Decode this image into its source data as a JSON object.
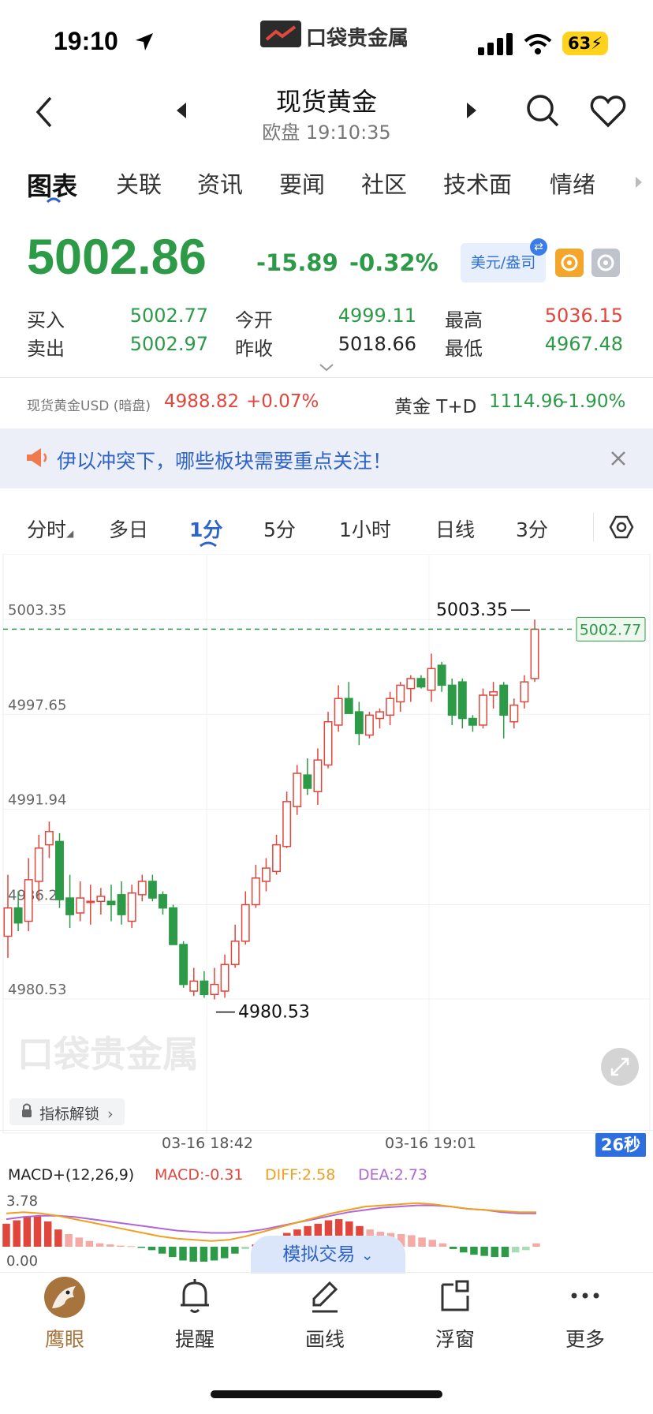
{
  "status_bar": {
    "time": "19:10",
    "app_logo": "口袋贵金属",
    "battery": "63"
  },
  "header": {
    "title": "现货黄金",
    "subtitle": "欧盘 19:10:35"
  },
  "tabs": [
    "图表",
    "关联",
    "资讯",
    "要闻",
    "社区",
    "技术面",
    "情绪"
  ],
  "price": {
    "last": "5002.86",
    "change": "-15.89",
    "change_pct": "-0.32%",
    "currency_label": "美元/盎司",
    "direction": "down"
  },
  "quote": {
    "bid_label": "买入",
    "bid": "5002.77",
    "ask_label": "卖出",
    "ask": "5002.97",
    "open_label": "今开",
    "open": "4999.11",
    "prev_close_label": "昨收",
    "prev_close": "5018.66",
    "high_label": "最高",
    "high": "5036.15",
    "low_label": "最低",
    "low": "4967.48"
  },
  "ticker": {
    "left_name": "现货黄金USD (暗盘)",
    "left_price": "4988.82",
    "left_change": "+0.07%",
    "right_name": "黄金 T+D",
    "right_price": "1114.96",
    "right_change": "-1.90%"
  },
  "banner": {
    "text": "伊以冲突下，哪些板块需要重点关注！"
  },
  "periods": [
    "分时",
    "多日",
    "1分",
    "5分",
    "1小时",
    "日线",
    "3分"
  ],
  "chart_data": {
    "type": "candlestick",
    "interval": "1分",
    "y_ticks": [
      "5003.35",
      "4997.65",
      "4991.94",
      "4986.2",
      "4980.53"
    ],
    "ylim": [
      4979.53,
      5004.45
    ],
    "x_ticks": [
      "03-16 18:42",
      "03-16 19:01"
    ],
    "max_label": "5003.35",
    "min_label": "4980.53",
    "last_price_tag": "5002.77",
    "up_color": "#e0463c",
    "down_color": "#2c9a47",
    "ohlc": [
      [
        4984.3,
        4988.0,
        4983.0,
        4986.0
      ],
      [
        4986.0,
        4987.0,
        4984.6,
        4985.1
      ],
      [
        4985.2,
        4989.0,
        4984.6,
        4987.7
      ],
      [
        4987.6,
        4990.4,
        4986.4,
        4989.6
      ],
      [
        4989.8,
        4991.2,
        4989.0,
        4990.6
      ],
      [
        4990.0,
        4990.5,
        4986.0,
        4986.5
      ],
      [
        4986.6,
        4988.0,
        4984.8,
        4985.6
      ],
      [
        4985.7,
        4987.6,
        4985.2,
        4986.6
      ],
      [
        4986.4,
        4987.4,
        4985.0,
        4986.4
      ],
      [
        4986.4,
        4987.2,
        4985.6,
        4986.7
      ],
      [
        4986.4,
        4987.4,
        4985.2,
        4986.2
      ],
      [
        4986.8,
        4987.6,
        4985.0,
        4985.6
      ],
      [
        4985.2,
        4987.4,
        4984.8,
        4986.9
      ],
      [
        4986.8,
        4988.0,
        4986.4,
        4987.6
      ],
      [
        4987.6,
        4988.0,
        4986.4,
        4986.6
      ],
      [
        4986.8,
        4987.0,
        4985.6,
        4986.0
      ],
      [
        4986.0,
        4986.2,
        4983.8,
        4983.8
      ],
      [
        4983.8,
        4984.0,
        4981.2,
        4981.4
      ],
      [
        4981.0,
        4982.4,
        4980.7,
        4981.6
      ],
      [
        4981.6,
        4982.2,
        4980.6,
        4980.8
      ],
      [
        4980.8,
        4982.4,
        4980.5,
        4981.4
      ],
      [
        4981.0,
        4983.2,
        4980.6,
        4982.6
      ],
      [
        4982.6,
        4985.0,
        4982.4,
        4984.0
      ],
      [
        4984.0,
        4987.0,
        4983.8,
        4986.2
      ],
      [
        4986.2,
        4988.6,
        4986.0,
        4987.8
      ],
      [
        4987.6,
        4989.0,
        4987.0,
        4988.4
      ],
      [
        4988.2,
        4990.4,
        4988.0,
        4989.8
      ],
      [
        4989.7,
        4993.0,
        4989.6,
        4992.4
      ],
      [
        4992.1,
        4994.6,
        4991.6,
        4994.1
      ],
      [
        4994.0,
        4995.0,
        4992.8,
        4993.2
      ],
      [
        4993.0,
        4995.6,
        4992.2,
        4994.9
      ],
      [
        4994.6,
        4997.8,
        4994.4,
        4997.2
      ],
      [
        4997.0,
        4999.4,
        4996.6,
        4998.6
      ],
      [
        4998.6,
        4999.6,
        4997.8,
        4997.7
      ],
      [
        4997.8,
        4998.4,
        4995.8,
        4996.5
      ],
      [
        4996.4,
        4997.8,
        4996.2,
        4997.6
      ],
      [
        4997.4,
        4998.0,
        4996.8,
        4997.8
      ],
      [
        4997.6,
        4999.0,
        4997.0,
        4998.6
      ],
      [
        4998.4,
        4999.6,
        4997.8,
        4999.4
      ],
      [
        4999.2,
        5000.0,
        4998.4,
        4999.8
      ],
      [
        4999.8,
        5000.0,
        4999.2,
        4999.3
      ],
      [
        4999.1,
        5001.3,
        4998.4,
        5000.4
      ],
      [
        5000.6,
        5000.8,
        4999.0,
        4999.4
      ],
      [
        4999.4,
        4999.8,
        4997.0,
        4997.6
      ],
      [
        4999.6,
        4999.8,
        4996.8,
        4997.4
      ],
      [
        4997.4,
        4997.6,
        4996.6,
        4997.0
      ],
      [
        4997.0,
        4999.2,
        4996.8,
        4998.8
      ],
      [
        4998.8,
        4999.6,
        4998.0,
        4999.0
      ],
      [
        4999.4,
        4999.6,
        4996.2,
        4997.6
      ],
      [
        4997.2,
        4998.6,
        4996.8,
        4998.2
      ],
      [
        4998.4,
        5000.0,
        4998.0,
        4999.6
      ],
      [
        4999.8,
        5003.35,
        4999.6,
        5002.77
      ]
    ],
    "macd": {
      "label": "MACD+(12,26,9)",
      "macd": "MACD:-0.31",
      "diff": "DIFF:2.58",
      "dea": "DEA:2.73",
      "top_tick": "3.78",
      "zero_tick": "0.00",
      "colors": {
        "macd": "#e0463c",
        "diff": "#f0a020",
        "dea": "#b066d8"
      },
      "hist": [
        2.0,
        2.3,
        2.6,
        2.7,
        2.2,
        1.5,
        1.1,
        0.8,
        0.5,
        0.3,
        0.2,
        0.1,
        0.05,
        -0.1,
        -0.3,
        -0.6,
        -0.9,
        -1.2,
        -1.3,
        -1.3,
        -1.2,
        -1.0,
        -0.6,
        -0.2,
        0.2,
        0.5,
        0.8,
        1.2,
        1.5,
        1.8,
        2.0,
        2.3,
        2.4,
        2.2,
        1.8,
        1.5,
        1.3,
        1.2,
        1.1,
        1.0,
        0.8,
        0.6,
        0.3,
        -0.2,
        -0.5,
        -0.7,
        -0.8,
        -0.9,
        -0.9,
        -0.5,
        -0.3,
        0.3
      ],
      "diff_line": [
        2.9,
        3.0,
        2.9,
        2.7,
        2.4,
        2.1,
        1.8,
        1.5,
        1.2,
        0.9,
        0.7,
        0.6,
        0.5,
        0.6,
        0.9,
        1.3,
        1.7,
        2.1,
        2.5,
        2.9,
        3.2,
        3.5,
        3.6,
        3.7,
        3.8,
        3.7,
        3.5,
        3.3,
        3.2,
        3.1,
        3.0,
        3.0
      ],
      "dea_line": [
        2.4,
        2.6,
        2.7,
        2.7,
        2.6,
        2.4,
        2.2,
        2.0,
        1.8,
        1.6,
        1.4,
        1.3,
        1.2,
        1.2,
        1.3,
        1.5,
        1.8,
        2.1,
        2.4,
        2.7,
        3.0,
        3.2,
        3.4,
        3.5,
        3.6,
        3.6,
        3.5,
        3.3,
        3.2,
        3.0,
        2.9,
        2.9
      ]
    }
  },
  "chart_ui": {
    "unlock_label": "指标解锁",
    "countdown": "26秒",
    "sim_trade": "模拟交易"
  },
  "nav": [
    {
      "label": "鹰眼",
      "icon": "eagle-icon"
    },
    {
      "label": "提醒",
      "icon": "bell-icon"
    },
    {
      "label": "画线",
      "icon": "pen-icon"
    },
    {
      "label": "浮窗",
      "icon": "float-window-icon"
    },
    {
      "label": "更多",
      "icon": "more-icon"
    }
  ]
}
